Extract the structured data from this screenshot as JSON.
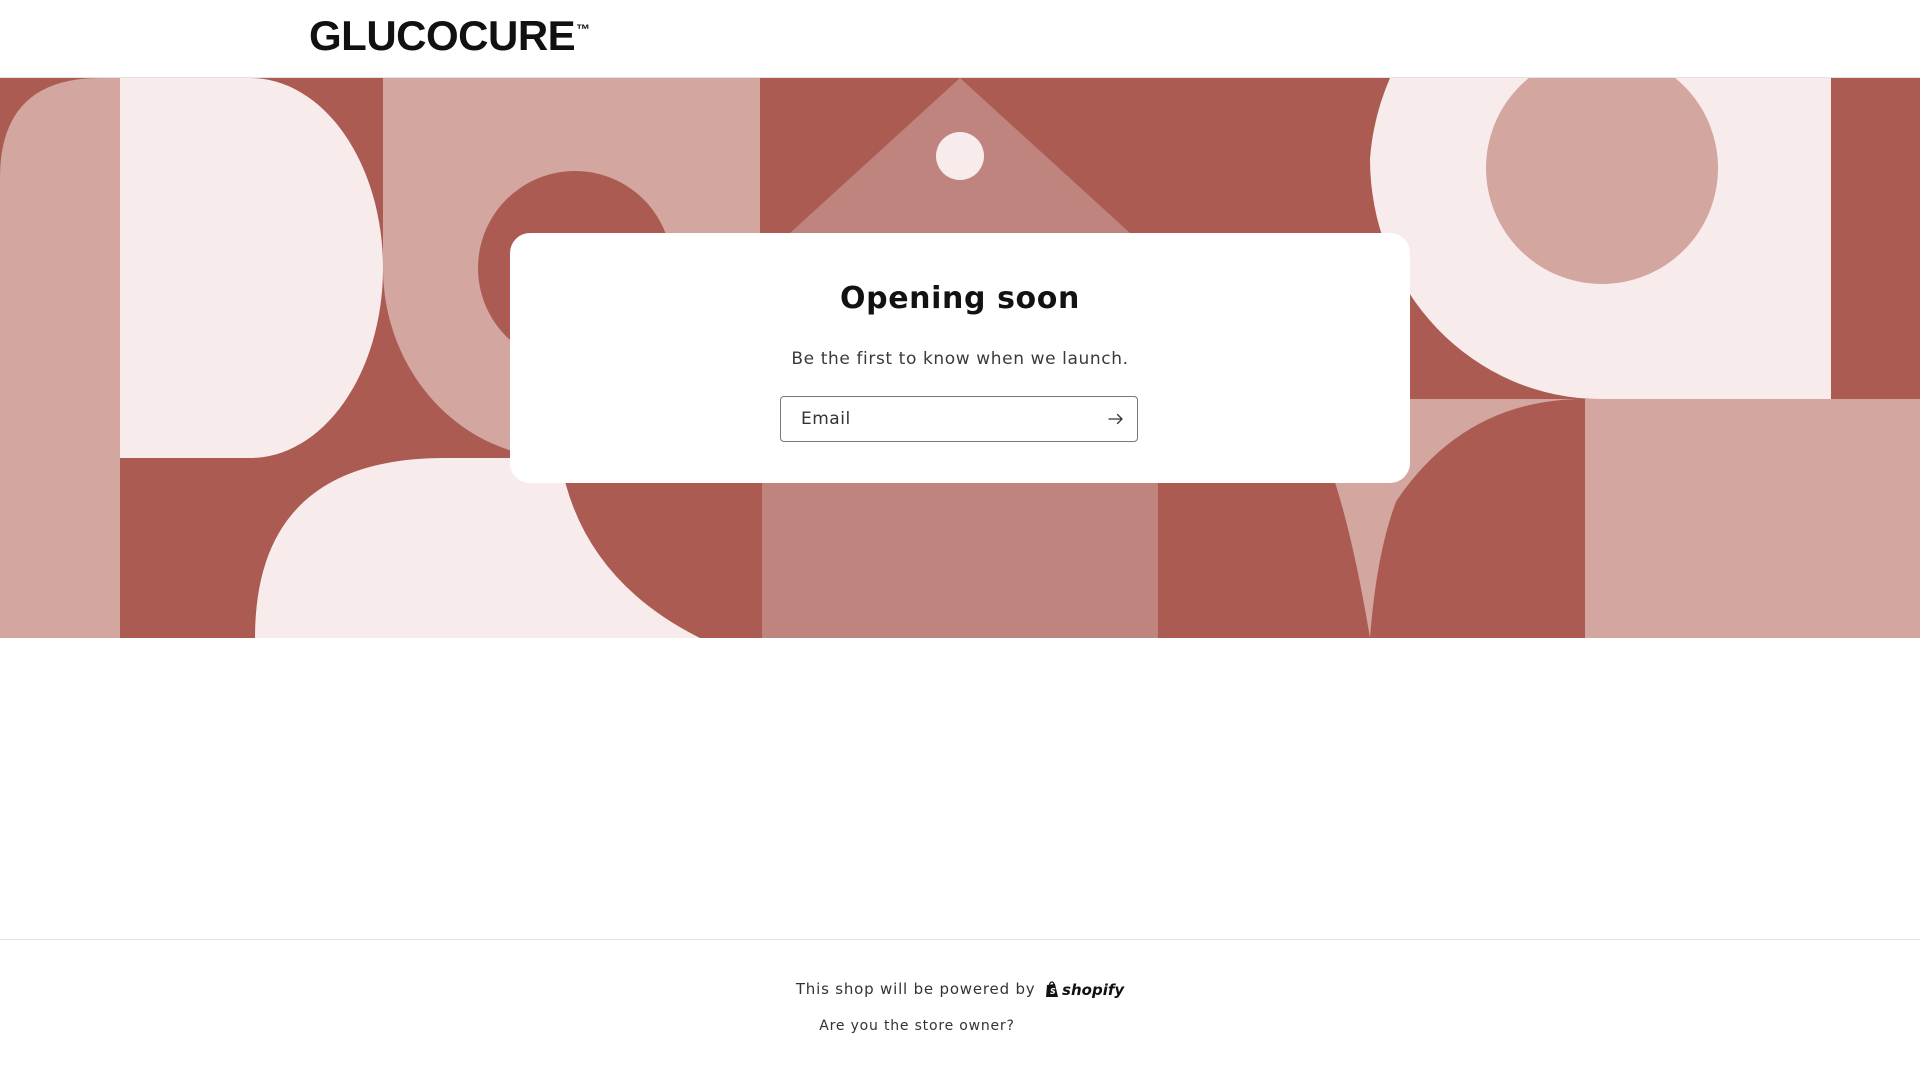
{
  "header": {
    "logo_text": "GLUCOCURE",
    "logo_mark": "™"
  },
  "card": {
    "title": "Opening soon",
    "subtitle": "Be the first to know when we launch.",
    "email_placeholder": "Email",
    "submit_icon": "arrow-right-icon"
  },
  "footer": {
    "powered_text": "This shop will be powered by",
    "brand": "shopify",
    "brand_icon": "shopify-bag-icon",
    "owner_link": "Are you the store owner?"
  },
  "colors": {
    "dark": "#ab5b52",
    "mid": "#c0847e",
    "light": "#d3a6a0",
    "pale": "#f7eceb"
  }
}
